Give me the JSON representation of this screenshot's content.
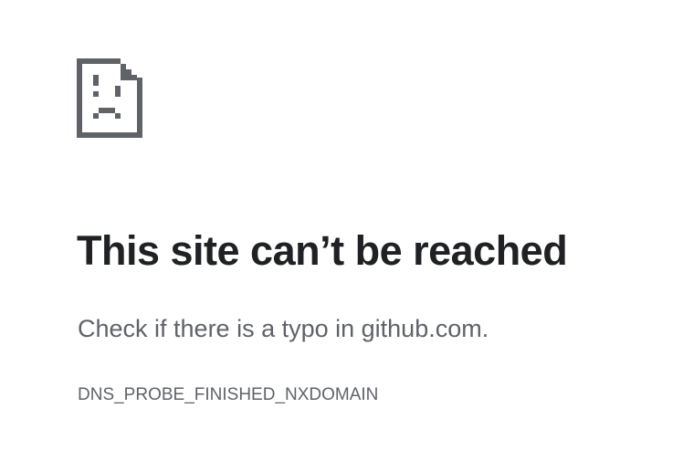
{
  "error_page": {
    "icon": "sad-page-icon",
    "heading": "This site can’t be reached",
    "suggestion": "Check if there is a typo in github.com.",
    "error_code": "DNS_PROBE_FINISHED_NXDOMAIN",
    "colors": {
      "heading": "#202124",
      "body_text": "#5f6368",
      "icon": "#5f6368",
      "background": "#ffffff"
    }
  }
}
